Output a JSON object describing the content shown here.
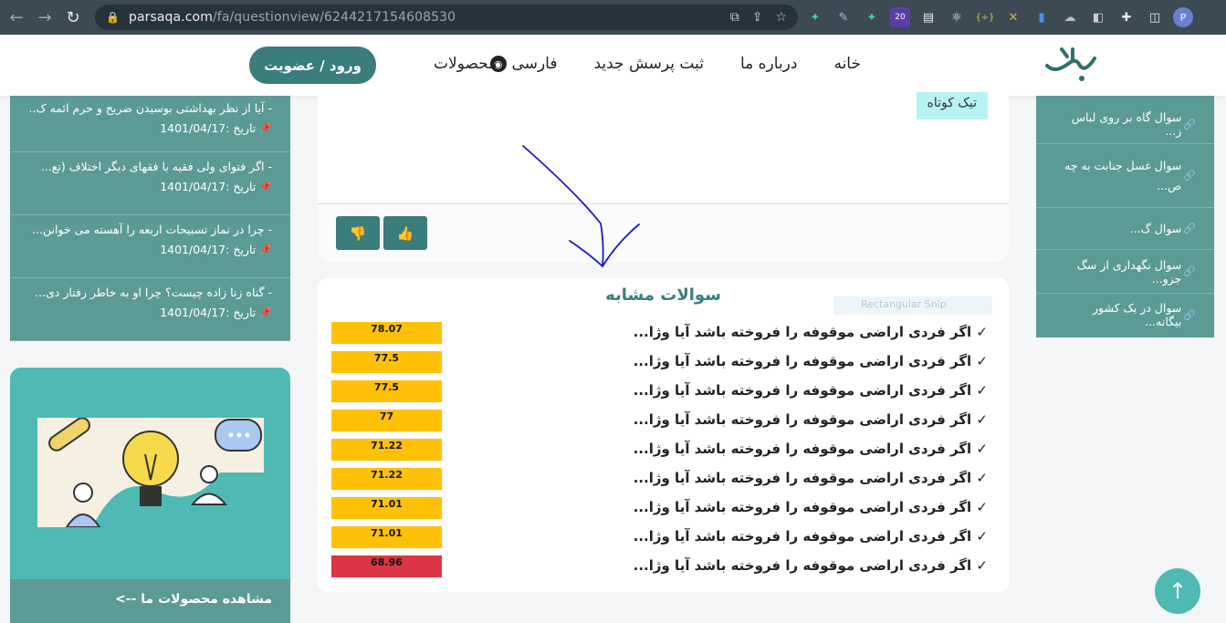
{
  "browser": {
    "url_host": "parsaqa.com",
    "url_path": "/fa/questionview/6244217154608530",
    "ext_badge": "20",
    "profile_letter": "P"
  },
  "header": {
    "logo_text": "پارسا",
    "menu": [
      "خانه",
      "درباره ما",
      "ثبت پرسش جدید",
      "فارسی"
    ],
    "products": "محصولات",
    "login": "ورود / عضویت"
  },
  "left_sidebar": {
    "items": [
      {
        "title": "- آیا از نظر بهداشتی بوسیدن ضریح و حرم ائمه ک...",
        "date": "تاریخ :1401/04/17"
      },
      {
        "title": "- اگر فتوای ولی فقیه با فقهای دیگر اختلاف (تع...",
        "date": "تاریخ :1401/04/17"
      },
      {
        "title": "- چرا در نماز تسبیحات اربعه را آهسته می خوانن...",
        "date": "تاریخ :1401/04/17"
      },
      {
        "title": "- گناه زنا زاده چیست؟ چرا او به خاطر رفتار دی...",
        "date": "تاریخ :1401/04/17"
      }
    ],
    "promo_footer": "مشاهده محصولات ما -->"
  },
  "right_sidebar": {
    "items": [
      "سوال گاه بر روی لباس ز...",
      "سوال غسل جنابت به چه ص...",
      "سوال گ...",
      "سوال نگهداری از سگ جزو...",
      "سوال در یک کشور بیگانه..."
    ]
  },
  "main": {
    "tag": "تیک کوتاه"
  },
  "similar": {
    "title": "سوالات مشابه",
    "snip_label": "Rectangular Snip",
    "rows": [
      {
        "text": "✓ اگر فردی اراضی موقوفه را فروخته باشد آیا وژا...",
        "score": "78.07",
        "status": "yellow"
      },
      {
        "text": "✓ اگر فردی اراضی موقوفه را فروخته باشد آیا وژا...",
        "score": "77.5",
        "status": "yellow"
      },
      {
        "text": "✓ اگر فردی اراضی موقوفه را فروخته باشد آیا وژا...",
        "score": "77.5",
        "status": "yellow"
      },
      {
        "text": "✓ اگر فردی اراضی موقوفه را فروخته باشد آیا وژا...",
        "score": "77",
        "status": "yellow"
      },
      {
        "text": "✓ اگر فردی اراضی موقوفه را فروخته باشد آیا وژا...",
        "score": "71.22",
        "status": "yellow"
      },
      {
        "text": "✓ اگر فردی اراضی موقوفه را فروخته باشد آیا وژا...",
        "score": "71.22",
        "status": "yellow"
      },
      {
        "text": "✓ اگر فردی اراضی موقوفه را فروخته باشد آیا وژا...",
        "score": "71.01",
        "status": "yellow"
      },
      {
        "text": "✓ اگر فردی اراضی موقوفه را فروخته باشد آیا وژا...",
        "score": "71.01",
        "status": "yellow"
      },
      {
        "text": "✓ اگر فردی اراضی موقوفه را فروخته باشد آیا وژا...",
        "score": "68.96",
        "status": "red"
      }
    ]
  },
  "colors": {
    "accent": "#3a7d7a",
    "sidebar": "#5c9a96",
    "score_yellow": "#ffc107",
    "score_red": "#dc3545",
    "annotation": "#1a1acc"
  }
}
